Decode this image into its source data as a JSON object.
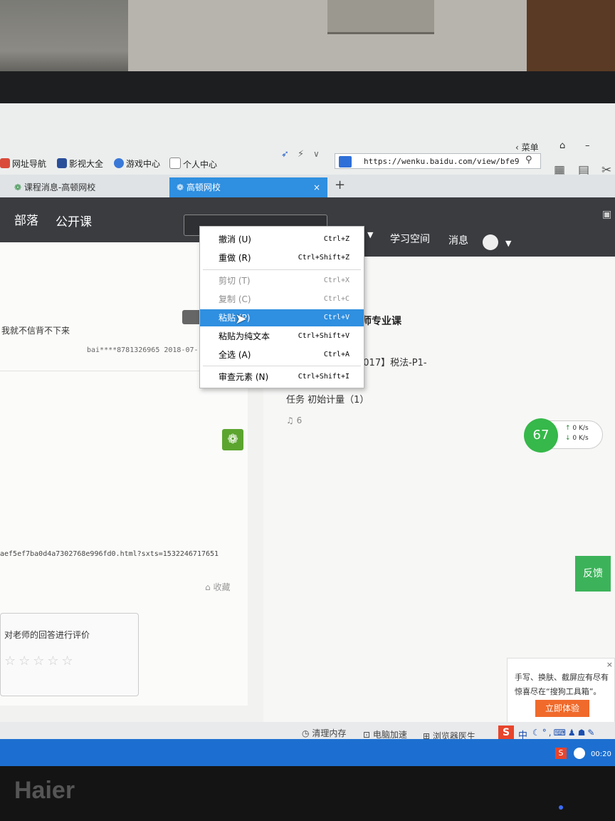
{
  "browser": {
    "menu_label": "菜单",
    "url": "https://wenku.baidu.com/view/bfe9",
    "bookmarks": [
      "网址导航",
      "影视大全",
      "游戏中心",
      "个人中心"
    ]
  },
  "tabs": [
    {
      "label": "课程消息-高顿网校",
      "active": false
    },
    {
      "label": "高顿网校",
      "active": true
    }
  ],
  "nav": {
    "left_items": [
      "部落",
      "公开课"
    ],
    "right_items": [
      "学习空间",
      "消息"
    ]
  },
  "left_content": {
    "question_text": "我就不信背不下来",
    "meta": "bai****8781326965 2018-07-",
    "link_text": "aef5ef7ba0d4a7302768e996fd0.html?sxts=1532246717651",
    "collect_label": "收藏",
    "rating_prompt": "对老师的回答进行评价"
  },
  "right_content": {
    "heading": "师专业课",
    "course": "2017】税法-P1-",
    "task": "任务 初始计量（1）",
    "count": "6"
  },
  "speed_widget": {
    "percent": "67",
    "up": "0 K/s",
    "down": "0 K/s"
  },
  "feedback_label": "反馈",
  "toast": {
    "line1": "手写、换肤、截屏应有尽有",
    "line2": "惊喜尽在“搜狗工具箱”。",
    "button": "立即体验"
  },
  "statusbar": [
    "清理内存",
    "电脑加速",
    "浏览器医生"
  ],
  "taskbar": {
    "clock": "00:20",
    "ime": "中"
  },
  "context_menu": [
    {
      "label": "撤消 (U)",
      "shortcut": "Ctrl+Z",
      "state": "normal"
    },
    {
      "label": "重做 (R)",
      "shortcut": "Ctrl+Shift+Z",
      "state": "normal"
    },
    {
      "label": "剪切 (T)",
      "shortcut": "Ctrl+X",
      "state": "disabled"
    },
    {
      "label": "复制 (C)",
      "shortcut": "Ctrl+C",
      "state": "disabled"
    },
    {
      "label": "粘贴 (P)",
      "shortcut": "Ctrl+V",
      "state": "highlighted"
    },
    {
      "label": "粘贴为纯文本",
      "shortcut": "Ctrl+Shift+V",
      "state": "normal"
    },
    {
      "label": "全选 (A)",
      "shortcut": "Ctrl+A",
      "state": "normal"
    },
    {
      "label": "审查元素 (N)",
      "shortcut": "Ctrl+Shift+I",
      "state": "normal"
    }
  ],
  "monitor_brand": "Haier"
}
